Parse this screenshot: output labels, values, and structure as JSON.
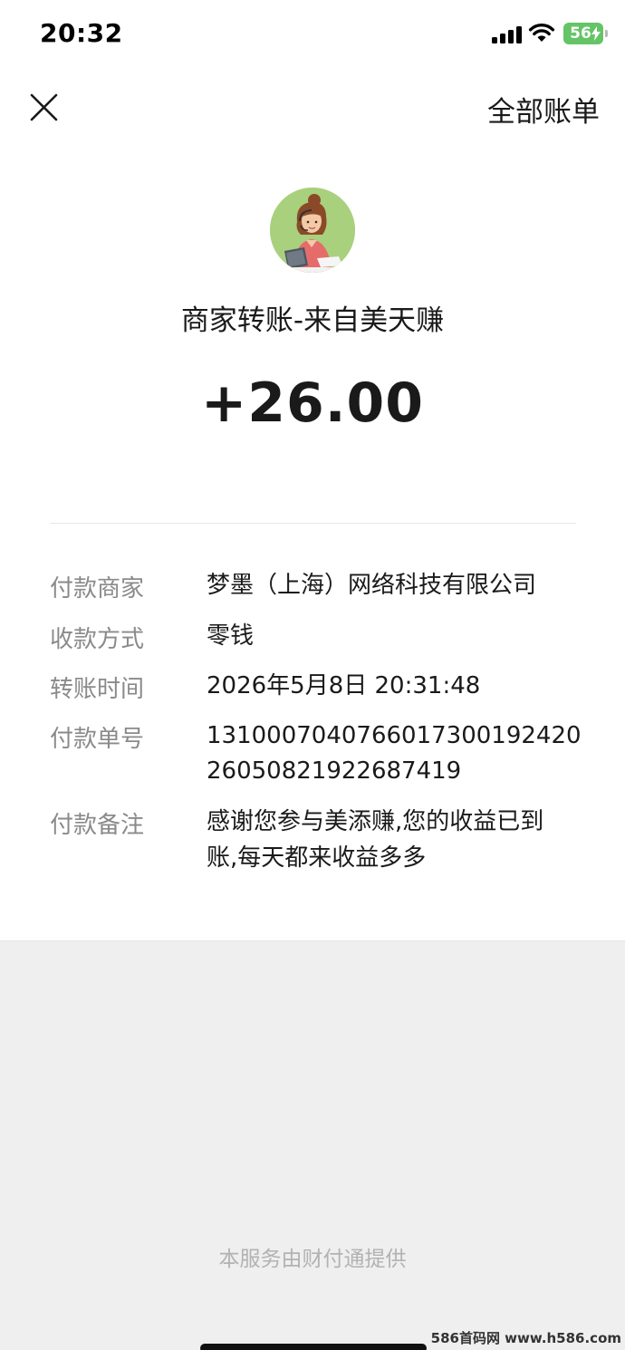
{
  "status_bar": {
    "time": "20:32",
    "battery": "56",
    "battery_color": "#65c466"
  },
  "nav": {
    "close_icon": "close-icon",
    "all_bills_label": "全部账单"
  },
  "header": {
    "avatar_icon": "customer-service-avatar",
    "merchant_title": "商家转账-来自美天赚",
    "amount": "+26.00"
  },
  "details": {
    "payer_label": "付款商家",
    "payer_value": "梦墨（上海）网络科技有限公司",
    "method_label": "收款方式",
    "method_value": "零钱",
    "time_label": "转账时间",
    "time_value": "2026年5月8日 20:31:48",
    "order_label": "付款单号",
    "order_value_line1": "1310007040766017300192420",
    "order_value_line2": "26050821922687419",
    "remark_label": "付款备注",
    "remark_value_line1": "感谢您参与美添赚,您的收益已到",
    "remark_value_line2": "账,每天都来收益多多"
  },
  "footer": {
    "provider_note": "本服务由财付通提供",
    "watermark": "586首码网 www.h586.com"
  }
}
